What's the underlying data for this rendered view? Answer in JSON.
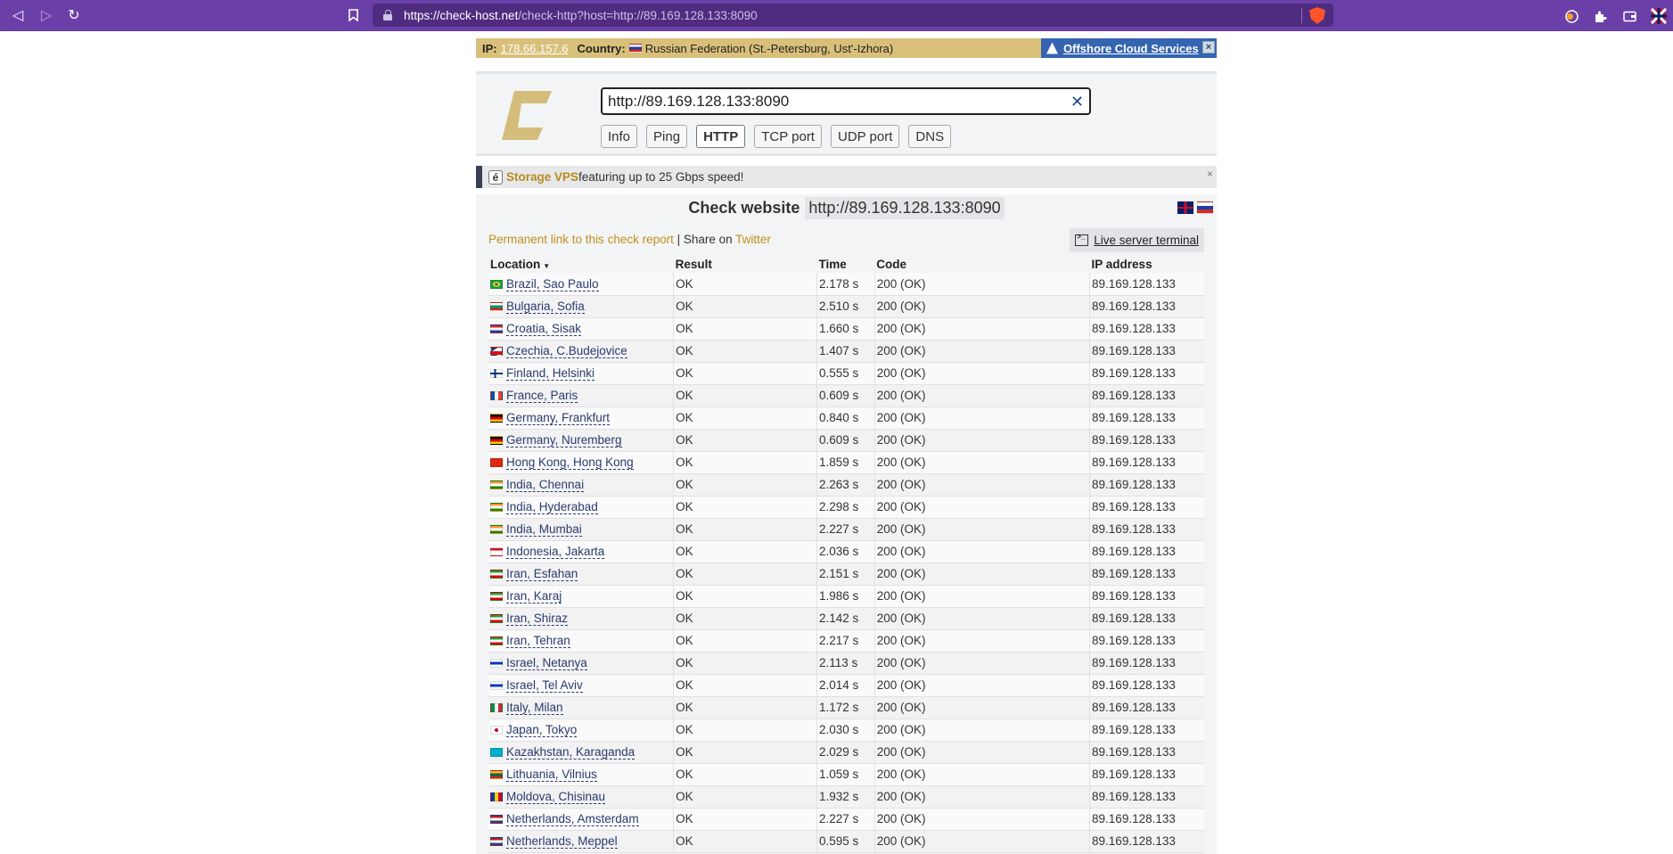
{
  "browser": {
    "url_domain": "https://check-host.net",
    "url_rest": "/check-http?host=http://89.169.128.133:8090"
  },
  "ipbar": {
    "ip_label": "IP:",
    "ip_value": "178.66.157.6",
    "country_label": "Country:",
    "country_value": "Russian Federation (St.-Petersburg, Ust'-Izhora)",
    "offshore_label": "Offshore Cloud Services",
    "close_label": "×"
  },
  "search": {
    "value": "http://89.169.128.133:8090",
    "clear_label": "✕",
    "tools": [
      "Info",
      "Ping",
      "HTTP",
      "TCP port",
      "UDP port",
      "DNS"
    ],
    "active_tool": "HTTP"
  },
  "promo": {
    "badge": "é",
    "highlight": "Storage VPS",
    "text": " featuring up to 25 Gbps speed!",
    "close_label": "×"
  },
  "check": {
    "title": "Check website",
    "host": "http://89.169.128.133:8090",
    "permalink": "Permanent link to this check report",
    "share_sep": " | Share on ",
    "twitter": "Twitter",
    "terminal_label": "Live server terminal"
  },
  "table": {
    "headers": {
      "location": "Location",
      "result": "Result",
      "time": "Time",
      "code": "Code",
      "ip": "IP address"
    },
    "rows": [
      {
        "flag": "br",
        "location": "Brazil, Sao Paulo",
        "result": "OK",
        "time": "2.178 s",
        "code": "200 (OK)",
        "ip": "89.169.128.133"
      },
      {
        "flag": "bg",
        "location": "Bulgaria, Sofia",
        "result": "OK",
        "time": "2.510 s",
        "code": "200 (OK)",
        "ip": "89.169.128.133"
      },
      {
        "flag": "hr",
        "location": "Croatia, Sisak",
        "result": "OK",
        "time": "1.660 s",
        "code": "200 (OK)",
        "ip": "89.169.128.133"
      },
      {
        "flag": "cz",
        "location": "Czechia, C.Budejovice",
        "result": "OK",
        "time": "1.407 s",
        "code": "200 (OK)",
        "ip": "89.169.128.133"
      },
      {
        "flag": "fi",
        "location": "Finland, Helsinki",
        "result": "OK",
        "time": "0.555 s",
        "code": "200 (OK)",
        "ip": "89.169.128.133"
      },
      {
        "flag": "fr",
        "location": "France, Paris",
        "result": "OK",
        "time": "0.609 s",
        "code": "200 (OK)",
        "ip": "89.169.128.133"
      },
      {
        "flag": "de",
        "location": "Germany, Frankfurt",
        "result": "OK",
        "time": "0.840 s",
        "code": "200 (OK)",
        "ip": "89.169.128.133"
      },
      {
        "flag": "de",
        "location": "Germany, Nuremberg",
        "result": "OK",
        "time": "0.609 s",
        "code": "200 (OK)",
        "ip": "89.169.128.133"
      },
      {
        "flag": "hk",
        "location": "Hong Kong, Hong Kong",
        "result": "OK",
        "time": "1.859 s",
        "code": "200 (OK)",
        "ip": "89.169.128.133"
      },
      {
        "flag": "in",
        "location": "India, Chennai",
        "result": "OK",
        "time": "2.263 s",
        "code": "200 (OK)",
        "ip": "89.169.128.133"
      },
      {
        "flag": "in",
        "location": "India, Hyderabad",
        "result": "OK",
        "time": "2.298 s",
        "code": "200 (OK)",
        "ip": "89.169.128.133"
      },
      {
        "flag": "in",
        "location": "India, Mumbai",
        "result": "OK",
        "time": "2.227 s",
        "code": "200 (OK)",
        "ip": "89.169.128.133"
      },
      {
        "flag": "id",
        "location": "Indonesia, Jakarta",
        "result": "OK",
        "time": "2.036 s",
        "code": "200 (OK)",
        "ip": "89.169.128.133"
      },
      {
        "flag": "ir",
        "location": "Iran, Esfahan",
        "result": "OK",
        "time": "2.151 s",
        "code": "200 (OK)",
        "ip": "89.169.128.133"
      },
      {
        "flag": "ir",
        "location": "Iran, Karaj",
        "result": "OK",
        "time": "1.986 s",
        "code": "200 (OK)",
        "ip": "89.169.128.133"
      },
      {
        "flag": "ir",
        "location": "Iran, Shiraz",
        "result": "OK",
        "time": "2.142 s",
        "code": "200 (OK)",
        "ip": "89.169.128.133"
      },
      {
        "flag": "ir",
        "location": "Iran, Tehran",
        "result": "OK",
        "time": "2.217 s",
        "code": "200 (OK)",
        "ip": "89.169.128.133"
      },
      {
        "flag": "il",
        "location": "Israel, Netanya",
        "result": "OK",
        "time": "2.113 s",
        "code": "200 (OK)",
        "ip": "89.169.128.133"
      },
      {
        "flag": "il",
        "location": "Israel, Tel Aviv",
        "result": "OK",
        "time": "2.014 s",
        "code": "200 (OK)",
        "ip": "89.169.128.133"
      },
      {
        "flag": "it",
        "location": "Italy, Milan",
        "result": "OK",
        "time": "1.172 s",
        "code": "200 (OK)",
        "ip": "89.169.128.133"
      },
      {
        "flag": "jp",
        "location": "Japan, Tokyo",
        "result": "OK",
        "time": "2.030 s",
        "code": "200 (OK)",
        "ip": "89.169.128.133"
      },
      {
        "flag": "kz",
        "location": "Kazakhstan, Karaganda",
        "result": "OK",
        "time": "2.029 s",
        "code": "200 (OK)",
        "ip": "89.169.128.133"
      },
      {
        "flag": "lt",
        "location": "Lithuania, Vilnius",
        "result": "OK",
        "time": "1.059 s",
        "code": "200 (OK)",
        "ip": "89.169.128.133"
      },
      {
        "flag": "md",
        "location": "Moldova, Chisinau",
        "result": "OK",
        "time": "1.932 s",
        "code": "200 (OK)",
        "ip": "89.169.128.133"
      },
      {
        "flag": "nl",
        "location": "Netherlands, Amsterdam",
        "result": "OK",
        "time": "2.227 s",
        "code": "200 (OK)",
        "ip": "89.169.128.133"
      },
      {
        "flag": "nl",
        "location": "Netherlands, Meppel",
        "result": "OK",
        "time": "0.595 s",
        "code": "200 (OK)",
        "ip": "89.169.128.133"
      }
    ]
  },
  "colors": {
    "browser_bar": "#6b3fa8",
    "accent_gold": "#c0901a",
    "ipbar_bg": "#d9c07a",
    "offshore_bg": "#3564b0"
  },
  "flags": {
    "ru": [
      "#ffffff",
      "#1c3fa8",
      "#d52b1e"
    ],
    "br": [
      "#229e45",
      "#f8e509",
      "#229e45"
    ],
    "bg": [
      "#ffffff",
      "#00966e",
      "#d62612"
    ],
    "hr": [
      "#d52b1e",
      "#ffffff",
      "#1c3fa8"
    ],
    "cz": [
      "#ffffff",
      "#ffffff",
      "#d7141a"
    ],
    "fi": [
      "#ffffff",
      "#003580",
      "#ffffff"
    ],
    "fr": [
      "#0055a4",
      "#ffffff",
      "#ef4135"
    ],
    "de": [
      "#000000",
      "#dd0000",
      "#ffce00"
    ],
    "hk": [
      "#de2910",
      "#de2910",
      "#de2910"
    ],
    "in": [
      "#ff9933",
      "#ffffff",
      "#138808"
    ],
    "id": [
      "#ce1126",
      "#ffffff",
      "#ffffff"
    ],
    "ir": [
      "#239f40",
      "#ffffff",
      "#da0000"
    ],
    "il": [
      "#ffffff",
      "#0038b8",
      "#ffffff"
    ],
    "it": [
      "#009246",
      "#ffffff",
      "#ce2b37"
    ],
    "jp": [
      "#ffffff",
      "#bc002d",
      "#ffffff"
    ],
    "kz": [
      "#00afca",
      "#00afca",
      "#00afca"
    ],
    "lt": [
      "#fdb913",
      "#006a44",
      "#c1272d"
    ],
    "md": [
      "#003da5",
      "#ffd200",
      "#cc092f"
    ],
    "nl": [
      "#ae1c28",
      "#ffffff",
      "#21468b"
    ],
    "gb": [
      "#012169",
      "#ffffff",
      "#c8102e"
    ]
  },
  "language_flags": [
    "gb",
    "ru"
  ]
}
